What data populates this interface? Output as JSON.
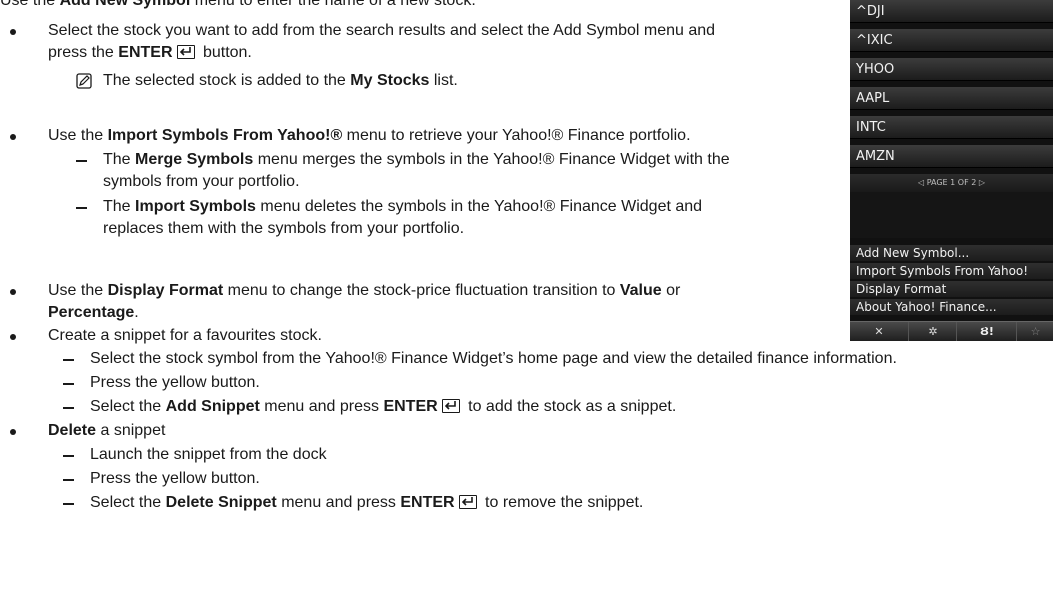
{
  "document": {
    "line0": {
      "pre": "Use the ",
      "bold": "Add New Symbol",
      "post": " menu to enter the name of a new stock."
    },
    "b1": {
      "pre": "Select the stock you want to add from the search results and select the Add Symbol menu and"
    },
    "b1b": {
      "pre": "press the ",
      "bold": "ENTER",
      "post": " button."
    },
    "note1": {
      "pre": "The selected stock is added to the ",
      "bold": "My Stocks",
      "post": " list."
    },
    "b2": {
      "pre": "Use the ",
      "bold": "Import Symbols From Yahoo!®",
      "post": " menu to retrieve your Yahoo!® Finance portfolio."
    },
    "d2a": {
      "pre": "The ",
      "bold": "Merge Symbols",
      "post": " menu merges the symbols in the Yahoo!® Finance Widget with the"
    },
    "d2a2": "symbols from your portfolio.",
    "d2b": {
      "pre": "The ",
      "bold": "Import Symbols",
      "post": " menu deletes the symbols in the Yahoo!® Finance Widget and"
    },
    "d2b2": "replaces them with the symbols from your portfolio.",
    "b3": {
      "pre": "Use the ",
      "bold": "Display Format",
      "mid": " menu to change the stock-price fluctuation transition to ",
      "bold2": "Value",
      "post": " or"
    },
    "b3b": "Percentage",
    "b3b_post": ".",
    "b4": "Create a snippet for a favourites stock.",
    "d4a": "Select the stock symbol from the Yahoo!® Finance Widget’s home page and view the detailed finance information.",
    "d4b": "Press the yellow button.",
    "d4c": {
      "pre": "Select the ",
      "bold": "Add Snippet",
      "mid": " menu and press ",
      "bold2": "ENTER",
      "post": " to add the stock as a snippet."
    },
    "b5": {
      "bold": "Delete",
      "post": " a snippet"
    },
    "d5a": "Launch the snippet from the dock",
    "d5b": "Press the yellow button.",
    "d5c": {
      "pre": "Select the ",
      "bold": "Delete Snippet",
      "mid": " menu and press ",
      "bold2": "ENTER",
      "post": " to remove the snippet."
    }
  },
  "widget": {
    "symbols": [
      "^DJI",
      "^IXIC",
      "YHOO",
      "AAPL",
      "INTC",
      "AMZN"
    ],
    "pager": "◁  PAGE 1 OF 2  ▷",
    "menu": [
      "Add New Symbol...",
      "Import Symbols From Yahoo!",
      "Display Format",
      "About Yahoo! Finance..."
    ],
    "toolbar": [
      "✕",
      "✲",
      "Ȣ!",
      "☆"
    ]
  }
}
